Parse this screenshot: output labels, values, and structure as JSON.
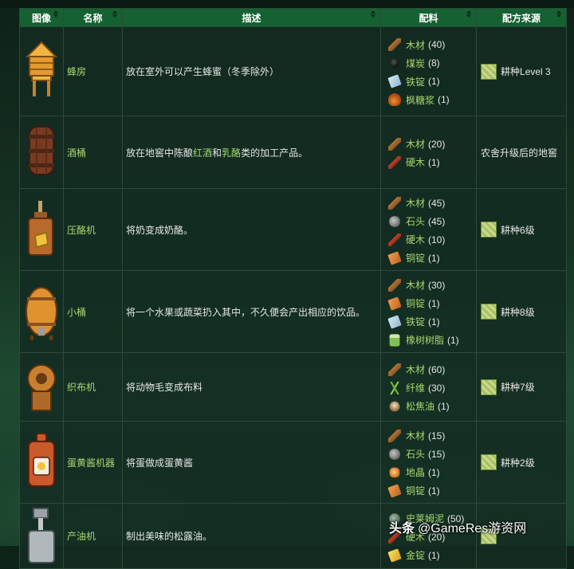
{
  "table": {
    "headers": [
      "图像",
      "名称",
      "描述",
      "配料",
      "配方来源"
    ],
    "rows": [
      {
        "name": "蜂房",
        "icon": "bee-house-icon",
        "desc_parts": [
          {
            "t": "放在室外可以产生蜂蜜（冬季除外）",
            "hl": false
          }
        ],
        "ingredients": [
          {
            "icon": "wood-icon",
            "name": "木材",
            "qty": "(40)"
          },
          {
            "icon": "coal-icon",
            "name": "煤炭",
            "qty": "(8)"
          },
          {
            "icon": "iron-bar-icon",
            "name": "铁锭",
            "qty": "(1)"
          },
          {
            "icon": "maple-syrup-icon",
            "name": "枫糖浆",
            "qty": "(1)"
          }
        ],
        "source": {
          "has_icon": true,
          "link": "耕种",
          "text": " Level 3"
        }
      },
      {
        "name": "酒桶",
        "icon": "keg-icon",
        "desc_parts": [
          {
            "t": "放在地窖中陈酿",
            "hl": false
          },
          {
            "t": "红酒",
            "hl": true
          },
          {
            "t": "和",
            "hl": false
          },
          {
            "t": "乳酪",
            "hl": true
          },
          {
            "t": "类的加工产品。",
            "hl": false
          }
        ],
        "ingredients": [
          {
            "icon": "wood-icon",
            "name": "木材",
            "qty": "(20)"
          },
          {
            "icon": "hardwood-icon",
            "name": "硬木",
            "qty": "(1)"
          }
        ],
        "source": {
          "has_icon": false,
          "link": "",
          "text": "农舍升级后的地窖"
        }
      },
      {
        "name": "压酪机",
        "icon": "cheese-press-icon",
        "desc_parts": [
          {
            "t": "将奶变成奶酪。",
            "hl": false
          }
        ],
        "ingredients": [
          {
            "icon": "wood-icon",
            "name": "木材",
            "qty": "(45)"
          },
          {
            "icon": "stone-icon",
            "name": "石头",
            "qty": "(45)"
          },
          {
            "icon": "hardwood-icon",
            "name": "硬木",
            "qty": "(10)"
          },
          {
            "icon": "copper-bar-icon",
            "name": "铜锭",
            "qty": "(1)"
          }
        ],
        "source": {
          "has_icon": true,
          "link": "耕种",
          "text": "6级"
        }
      },
      {
        "name": "小桶",
        "icon": "keg-small-icon",
        "desc_parts": [
          {
            "t": "将一个水果或蔬菜扔入其中，不久便会产出相应的饮品。",
            "hl": false
          }
        ],
        "ingredients": [
          {
            "icon": "wood-icon",
            "name": "木材",
            "qty": "(30)"
          },
          {
            "icon": "copper-bar-icon",
            "name": "铜锭",
            "qty": "(1)"
          },
          {
            "icon": "iron-bar-icon",
            "name": "铁锭",
            "qty": "(1)"
          },
          {
            "icon": "oak-resin-icon",
            "name": "橡树树脂",
            "qty": "(1)"
          }
        ],
        "source": {
          "has_icon": true,
          "link": "耕种",
          "text": "8级"
        }
      },
      {
        "name": "织布机",
        "icon": "loom-icon",
        "desc_parts": [
          {
            "t": "将动物毛变成布料",
            "hl": false
          }
        ],
        "ingredients": [
          {
            "icon": "wood-icon",
            "name": "木材",
            "qty": "(60)"
          },
          {
            "icon": "fiber-icon",
            "name": "纤维",
            "qty": "(30)"
          },
          {
            "icon": "pine-tar-icon",
            "name": "松焦油",
            "qty": "(1)"
          }
        ],
        "source": {
          "has_icon": true,
          "link": "耕种",
          "text": "7级"
        }
      },
      {
        "name": "蛋黄酱机器",
        "icon": "mayonnaise-machine-icon",
        "desc_parts": [
          {
            "t": "将蛋做成蛋黄酱",
            "hl": false
          }
        ],
        "ingredients": [
          {
            "icon": "wood-icon",
            "name": "木材",
            "qty": "(15)"
          },
          {
            "icon": "stone-icon",
            "name": "石头",
            "qty": "(15)"
          },
          {
            "icon": "earth-crystal-icon",
            "name": "地晶",
            "qty": "(1)"
          },
          {
            "icon": "copper-bar-icon",
            "name": "铜锭",
            "qty": "(1)"
          }
        ],
        "source": {
          "has_icon": true,
          "link": "耕种",
          "text": "2级"
        }
      },
      {
        "name": "产油机",
        "icon": "oil-maker-icon",
        "desc_parts": [
          {
            "t": "制出美味的松露油。",
            "hl": false
          }
        ],
        "ingredients": [
          {
            "icon": "slime-icon",
            "name": "史莱姆泥",
            "qty": "(50)"
          },
          {
            "icon": "hardwood-icon",
            "name": "硬木",
            "qty": "(20)"
          },
          {
            "icon": "gold-bar-icon",
            "name": "金锭",
            "qty": "(1)"
          }
        ],
        "source": {
          "has_icon": true,
          "link": "",
          "text": ""
        }
      }
    ]
  },
  "watermark": {
    "brand": "头条",
    "handle": "@GameRes游资网"
  }
}
